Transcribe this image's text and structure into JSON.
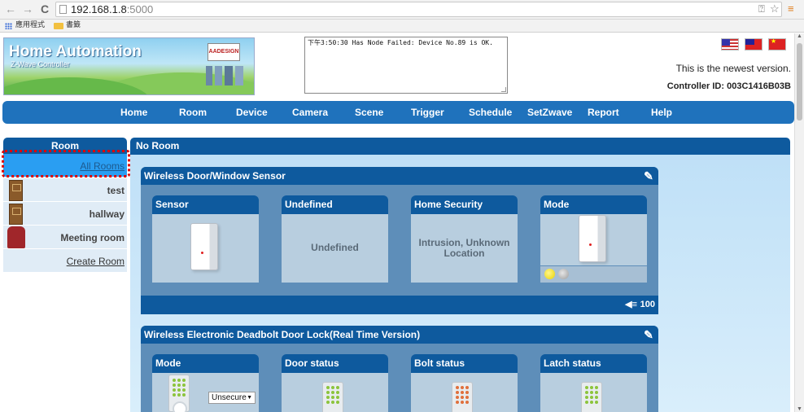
{
  "browser": {
    "back_icon": "←",
    "forward_icon": "→",
    "reload_icon": "C",
    "url_host": "192.168.1.8",
    "url_port": ":5000",
    "translate_icon": "⍰",
    "star_icon": "☆",
    "menu_icon": "≡",
    "bookmark_apps": "應用程式",
    "bookmark_folder": "書籤"
  },
  "header": {
    "banner_title": "Home Automation",
    "banner_subtitle": "Z-Wave Controller",
    "logo_text": "AADESIGN",
    "message": "下午3:50:30 Has Node Failed: Device No.89 is OK.",
    "version_text": "This is the newest version.",
    "controller_id": "Controller ID: 003C1416B03B"
  },
  "nav": {
    "items": [
      "Home",
      "Room",
      "Device",
      "Camera",
      "Scene",
      "Trigger",
      "Schedule",
      "SetZwave",
      "Report",
      "Help"
    ]
  },
  "room_panel": {
    "title": "Room",
    "items": [
      "All Rooms",
      "test",
      "hallway",
      "Meeting room",
      "Create Room"
    ]
  },
  "main": {
    "title": "No Room",
    "devices": [
      {
        "name": "Wireless Door/Window Sensor",
        "tiles": [
          {
            "title": "Sensor",
            "text": ""
          },
          {
            "title": "Undefined",
            "text": "Undefined"
          },
          {
            "title": "Home Security",
            "text": "Intrusion, Unknown Location"
          },
          {
            "title": "Mode",
            "text": ""
          }
        ],
        "battery": "100",
        "battery_icon": "◀≡"
      },
      {
        "name": "Wireless Electronic Deadbolt Door Lock(Real Time Version)",
        "tiles": [
          {
            "title": "Mode",
            "select_value": "Unsecure"
          },
          {
            "title": "Door status"
          },
          {
            "title": "Bolt status"
          },
          {
            "title": "Latch status"
          }
        ]
      }
    ],
    "edit_icon": "✎",
    "select_arrow": "▼"
  },
  "colors": {
    "nav_blue": "#1f72bc",
    "panel_dark_blue": "#0e5a9e",
    "active_row": "#2a9ef2",
    "selection_dotted": "#e00000",
    "led_yellow": "#f2e21a",
    "led_gray": "#b9b9b9",
    "lock_green": "#8cc43c",
    "lock_orange": "#e0703c"
  }
}
